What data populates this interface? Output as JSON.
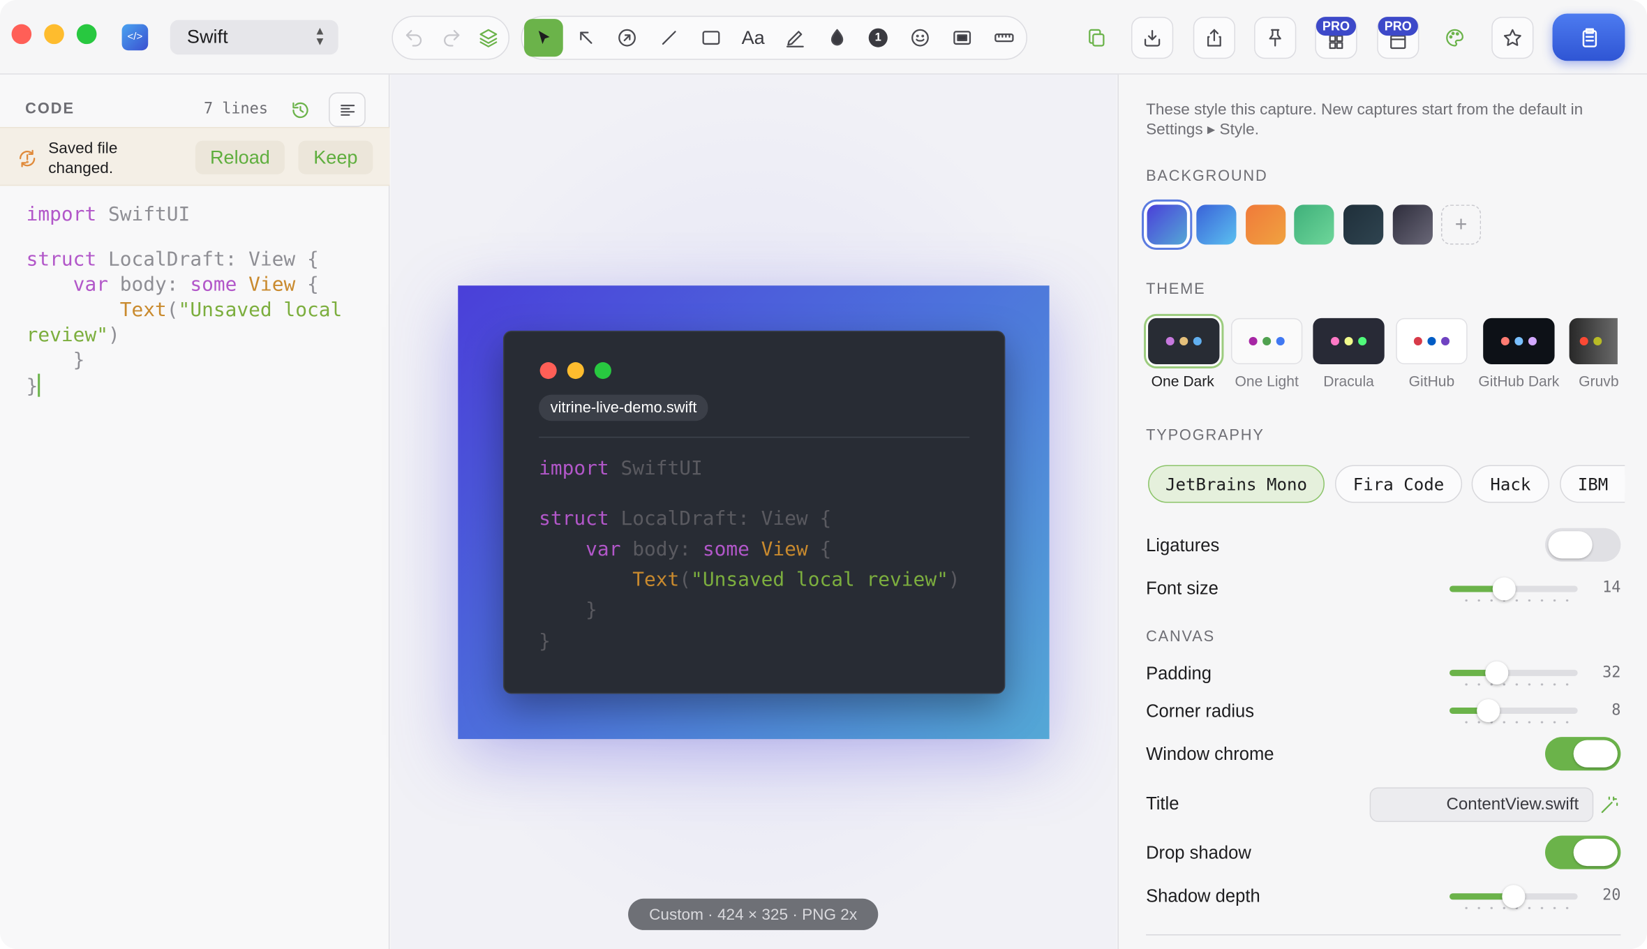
{
  "toolbar": {
    "language": "Swift",
    "pro_badge": "PRO"
  },
  "code_panel": {
    "header": "CODE",
    "line_count": "7 lines",
    "banner_text": "Saved file changed.",
    "reload_label": "Reload",
    "keep_label": "Keep"
  },
  "editor": {
    "lines": [
      [
        {
          "t": "import",
          "c": "k"
        },
        {
          "t": " SwiftUI",
          "c": "g"
        }
      ],
      [],
      [
        {
          "t": "struct",
          "c": "k"
        },
        {
          "t": " LocalDraft: View {",
          "c": "g"
        }
      ],
      [
        {
          "t": "    var",
          "c": "k"
        },
        {
          "t": " body: ",
          "c": "g"
        },
        {
          "t": "some",
          "c": "k"
        },
        {
          "t": " View",
          "c": "t"
        },
        {
          "t": " {",
          "c": "g"
        }
      ],
      [
        {
          "t": "        Text",
          "c": "t"
        },
        {
          "t": "(",
          "c": "g"
        },
        {
          "t": "\"Unsaved local",
          "c": "s"
        }
      ],
      [
        {
          "t": "review\"",
          "c": "s"
        },
        {
          "t": ")",
          "c": "g"
        }
      ],
      [
        {
          "t": "    }",
          "c": "g"
        }
      ],
      [
        {
          "t": "}",
          "c": "g"
        }
      ]
    ]
  },
  "preview": {
    "filename": "vitrine-live-demo.swift",
    "lines": [
      [
        {
          "t": "import",
          "c": "k"
        },
        {
          "t": " SwiftUI",
          "c": "w"
        }
      ],
      [],
      [
        {
          "t": "struct",
          "c": "k"
        },
        {
          "t": " LocalDraft: View {",
          "c": "w"
        }
      ],
      [
        {
          "t": "    var",
          "c": "k"
        },
        {
          "t": " body: ",
          "c": "w"
        },
        {
          "t": "some",
          "c": "k"
        },
        {
          "t": " View",
          "c": "t"
        },
        {
          "t": " {",
          "c": "w"
        }
      ],
      [
        {
          "t": "        Text",
          "c": "t"
        },
        {
          "t": "(",
          "c": "w"
        },
        {
          "t": "\"Unsaved local review\"",
          "c": "s"
        },
        {
          "t": ")",
          "c": "w"
        }
      ],
      [
        {
          "t": "    }",
          "c": "w"
        }
      ],
      [
        {
          "t": "}",
          "c": "w"
        }
      ]
    ],
    "status": "Custom · 424 × 325 · PNG 2x"
  },
  "style_panel": {
    "intro": "These style this capture. New captures start from the default in Settings ▸ Style.",
    "background_label": "BACKGROUND",
    "theme_label": "THEME",
    "themes": [
      "One Dark",
      "One Light",
      "Dracula",
      "GitHub",
      "GitHub Dark",
      "Gruvb"
    ],
    "typography_label": "TYPOGRAPHY",
    "fonts": [
      "JetBrains Mono",
      "Fira Code",
      "Hack",
      "IBM"
    ],
    "ligatures_label": "Ligatures",
    "font_size_label": "Font size",
    "font_size_value": "14",
    "font_size_fraction": 0.43,
    "canvas_label": "CANVAS",
    "padding_label": "Padding",
    "padding_value": "32",
    "padding_fraction": 0.37,
    "corner_label": "Corner radius",
    "corner_value": "8",
    "corner_fraction": 0.3,
    "window_chrome_label": "Window chrome",
    "title_label": "Title",
    "title_value": "ContentView.swift",
    "drop_shadow_label": "Drop shadow",
    "shadow_depth_label": "Shadow depth",
    "shadow_depth_value": "20",
    "shadow_depth_fraction": 0.5
  },
  "colors": {
    "accent_green": "#6bb34a",
    "pro_blue": "#3d49c9",
    "copy_blue": "#3b63e0",
    "editor_bg": "#282c34"
  }
}
